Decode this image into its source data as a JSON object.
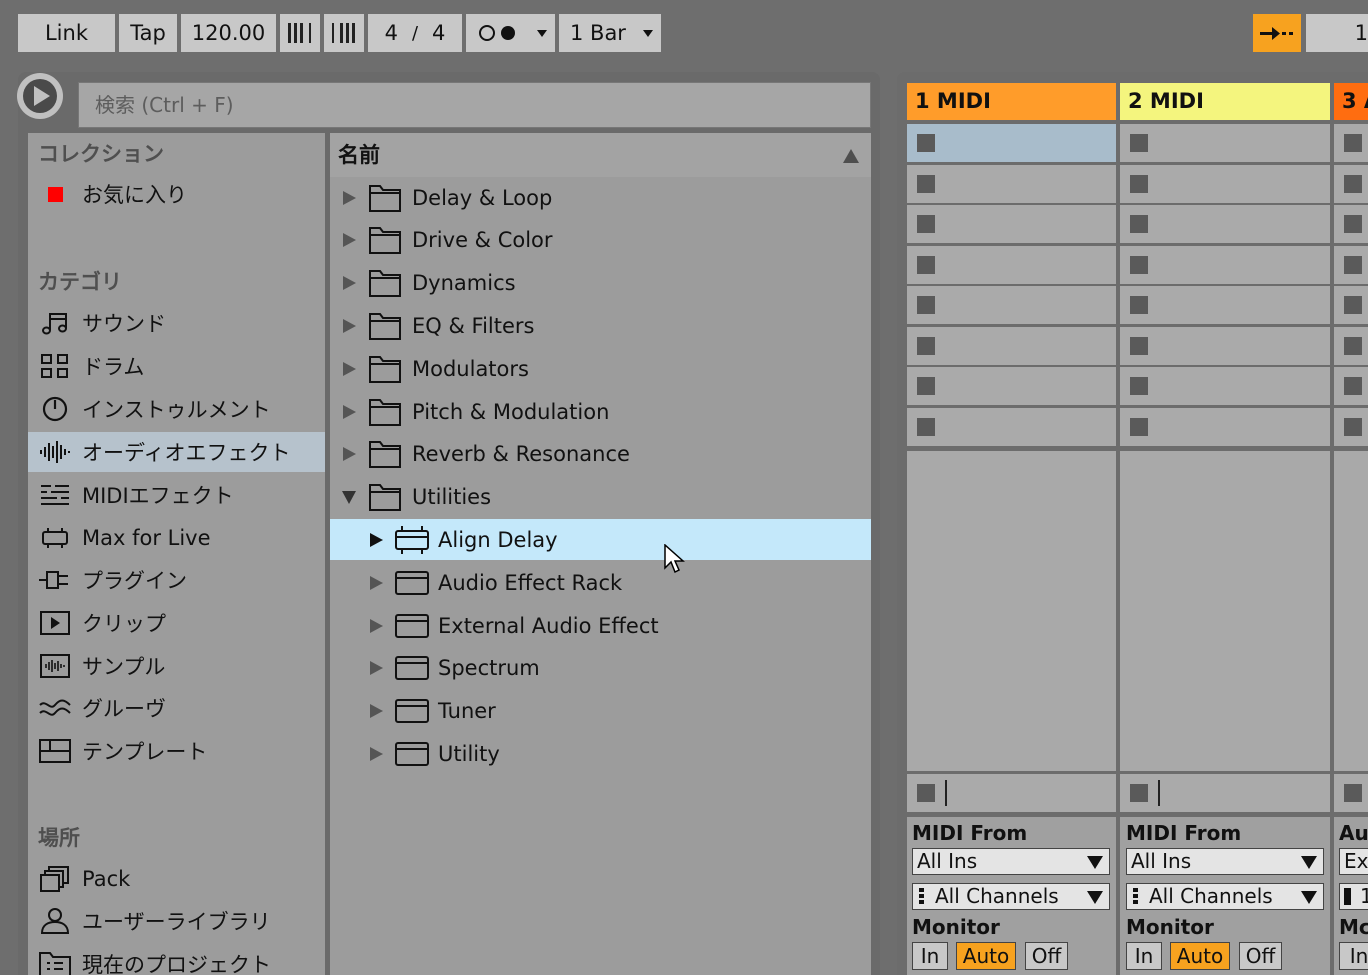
{
  "control_bar": {
    "link_label": "Link",
    "tap_label": "Tap",
    "tempo": "120.00",
    "sig_numerator": "4",
    "sig_slash": "/",
    "sig_denominator": "4",
    "quantize": "1 Bar",
    "right_cut_text": "1",
    "accent_color": "#f7a21f"
  },
  "browser": {
    "search_placeholder": "検索 (Ctrl + F)",
    "collections_header": "コレクション",
    "favorites_label": "お気に入り",
    "favorites_color": "#ff0000",
    "categories_header": "カテゴリ",
    "categories": [
      {
        "label": "サウンド",
        "icon": "music-note-icon"
      },
      {
        "label": "ドラム",
        "icon": "drum-grid-icon"
      },
      {
        "label": "インストゥルメント",
        "icon": "instrument-knob-icon"
      },
      {
        "label": "オーディオエフェクト",
        "icon": "audio-wave-icon",
        "selected": true
      },
      {
        "label": "MIDIエフェクト",
        "icon": "midi-lines-icon"
      },
      {
        "label": "Max for Live",
        "icon": "max-device-icon"
      },
      {
        "label": "プラグイン",
        "icon": "plug-icon"
      },
      {
        "label": "クリップ",
        "icon": "clip-play-icon"
      },
      {
        "label": "サンプル",
        "icon": "sample-wave-icon"
      },
      {
        "label": "グルーヴ",
        "icon": "groove-wave-icon"
      },
      {
        "label": "テンプレート",
        "icon": "template-icon"
      }
    ],
    "places_header": "場所",
    "places": [
      {
        "label": "Pack",
        "icon": "pack-icon"
      },
      {
        "label": "ユーザーライブラリ",
        "icon": "user-icon"
      },
      {
        "label": "現在のプロジェクト",
        "icon": "project-folder-icon"
      }
    ],
    "list_header": "名前",
    "folders": [
      "Delay & Loop",
      "Drive & Color",
      "Dynamics",
      "EQ & Filters",
      "Modulators",
      "Pitch & Modulation",
      "Reverb & Resonance",
      "Utilities"
    ],
    "devices": [
      "Align Delay",
      "Audio Effect Rack",
      "External Audio Effect",
      "Spectrum",
      "Tuner",
      "Utility"
    ],
    "selected_device": "Align Delay"
  },
  "session": {
    "tracks": [
      {
        "name": "1 MIDI",
        "color": "#ff9c2a"
      },
      {
        "name": "2 MIDI",
        "color": "#f4f57e"
      },
      {
        "name": "3 A",
        "color": "#ff6d10"
      }
    ],
    "track1_io": {
      "from_label": "MIDI From",
      "input": "All Ins",
      "channel": "All Channels",
      "monitor_label": "Monitor",
      "monitor_options": [
        "In",
        "Auto",
        "Off"
      ],
      "monitor_active": "Auto"
    },
    "track2_io": {
      "from_label": "MIDI From",
      "input": "All Ins",
      "channel": "All Channels",
      "monitor_label": "Monitor",
      "monitor_options": [
        "In",
        "Auto",
        "Off"
      ],
      "monitor_active": "Auto"
    },
    "track3_io": {
      "from_label": "Au",
      "input": "Ex",
      "channel": "1",
      "monitor_label": "Mc",
      "monitor_in": "In"
    }
  }
}
